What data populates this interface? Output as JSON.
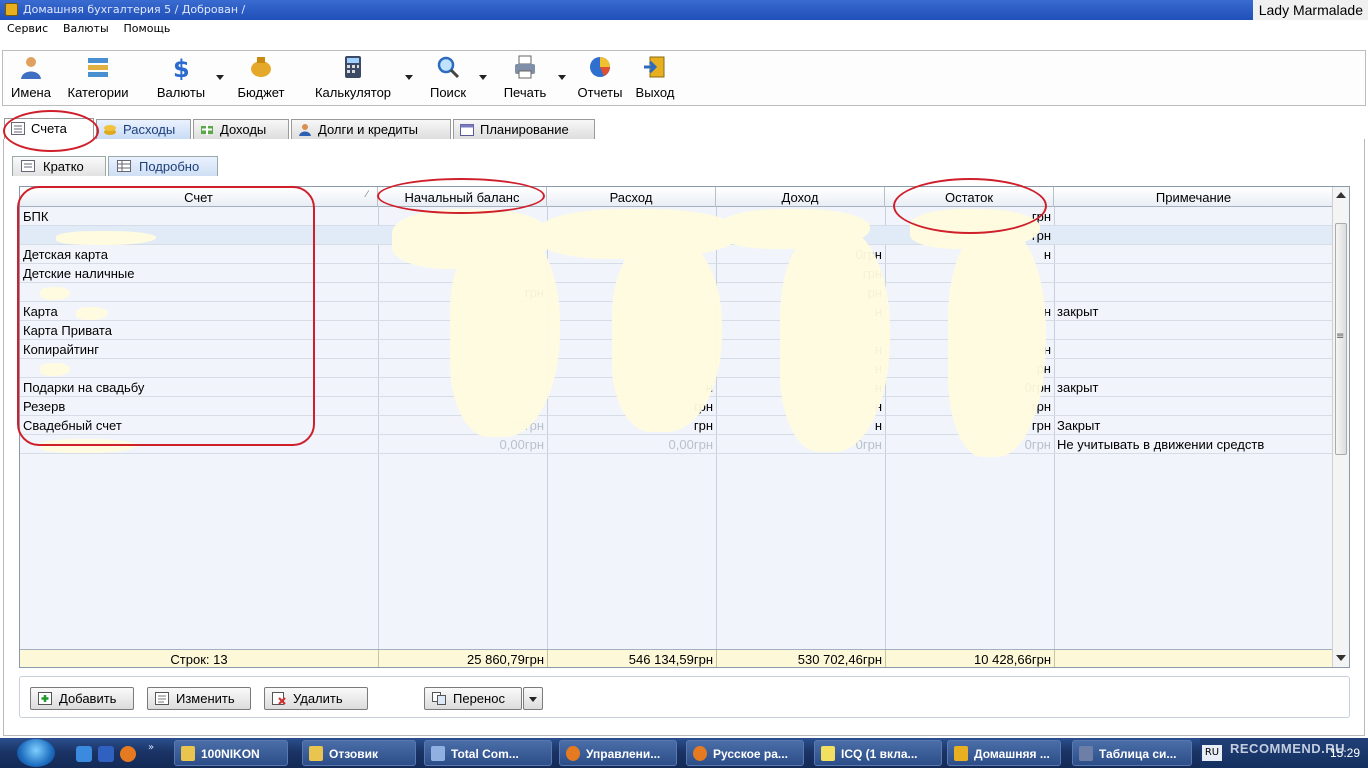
{
  "window": {
    "title": "Домашняя бухгалтерия 5  / Доброван /",
    "watermark_user": "Lady Marmalade"
  },
  "menu": [
    "Сервис",
    "Валюты",
    "Помощь"
  ],
  "toolbar": [
    {
      "label": "Имена",
      "icon": "names-icon"
    },
    {
      "label": "Категории",
      "icon": "categories-icon"
    },
    {
      "label": "Валюты",
      "icon": "currency-icon"
    },
    {
      "label": "Бюджет",
      "icon": "budget-icon"
    },
    {
      "label": "Калькулятор",
      "icon": "calculator-icon"
    },
    {
      "label": "Поиск",
      "icon": "search-icon"
    },
    {
      "label": "Печать",
      "icon": "print-icon"
    },
    {
      "label": "Отчеты",
      "icon": "reports-icon"
    },
    {
      "label": "Выход",
      "icon": "exit-icon"
    }
  ],
  "main_tabs": [
    {
      "label": "Счета",
      "active": true
    },
    {
      "label": "Расходы"
    },
    {
      "label": "Доходы"
    },
    {
      "label": "Долги и кредиты"
    },
    {
      "label": "Планирование"
    }
  ],
  "sub_tabs": [
    {
      "label": "Кратко"
    },
    {
      "label": "Подробно",
      "active": true
    }
  ],
  "table": {
    "columns": [
      "Счет",
      "Начальный баланс",
      "Расход",
      "Доход",
      "Остаток",
      "Примечание"
    ],
    "rows": [
      {
        "name": "БПК",
        "start": "",
        "expense": "",
        "income": "",
        "balance": "грн",
        "note": ""
      },
      {
        "name": "",
        "start": "",
        "expense": "",
        "income": "",
        "balance": "грн",
        "note": ""
      },
      {
        "name": "Детская карта",
        "start": "",
        "expense": "",
        "income": "0грн",
        "balance": "н",
        "note": ""
      },
      {
        "name": "Детские наличные",
        "start": "",
        "expense": "",
        "income": "грн",
        "balance": "",
        "note": ""
      },
      {
        "name": "",
        "start": "грн",
        "expense": "",
        "income": "рн",
        "balance": "",
        "note": ""
      },
      {
        "name": "Карта",
        "start": "",
        "expense": "",
        "income": "н",
        "balance": "н",
        "note": "закрыт"
      },
      {
        "name": "Карта Привата",
        "start": "",
        "expense": "",
        "income": "",
        "balance": "",
        "note": ""
      },
      {
        "name": "Копирайтинг",
        "start": "",
        "expense": "",
        "income": "н",
        "balance": "н",
        "note": ""
      },
      {
        "name": "",
        "start": "",
        "expense": "",
        "income": "н",
        "balance": "рн",
        "note": ""
      },
      {
        "name": "Подарки на свадьбу",
        "start": "",
        "expense": "н",
        "income": "н",
        "balance": "0грн",
        "note": "закрыт"
      },
      {
        "name": "Резерв",
        "start": "",
        "expense": "грн",
        "income": "н",
        "balance": "грн",
        "note": ""
      },
      {
        "name": "Свадебный счет",
        "start": "0,00грн",
        "expense": "грн",
        "income": "н",
        "balance": "грн",
        "note": "Закрыт"
      },
      {
        "name": "",
        "start": "0,00грн",
        "expense": "0,00грн",
        "income": "0грн",
        "balance": "0грн",
        "note": "Не учитывать в движении средств"
      }
    ],
    "footer": {
      "rows_label": "Строк: 13",
      "start_total": "25 860,79грн",
      "expense_total": "546 134,59грн",
      "income_total": "530 702,46грн",
      "balance_total": "10 428,66грн"
    }
  },
  "buttons": [
    "Добавить",
    "Изменить",
    "Удалить",
    "Перенос"
  ],
  "taskbar": {
    "tasks": [
      "100NIKON",
      "Отзовик",
      "Total Com...",
      "Управлени...",
      "Русское ра...",
      "ICQ (1 вкла...",
      "Домашняя ...",
      "Таблица си..."
    ],
    "lang": "RU",
    "clock": "15:29",
    "watermark": "RECOMMEND.RU"
  }
}
